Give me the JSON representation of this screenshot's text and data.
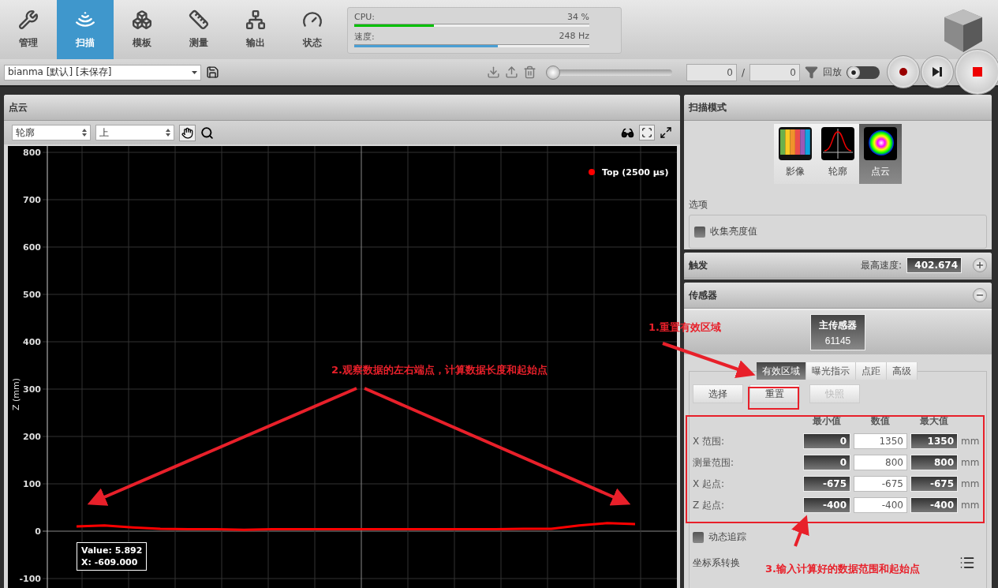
{
  "nav_tabs": [
    {
      "label": "管理",
      "kind": "tools",
      "selected": false
    },
    {
      "label": "扫描",
      "kind": "scan",
      "selected": true
    },
    {
      "label": "模板",
      "kind": "boxes",
      "selected": false
    },
    {
      "label": "测量",
      "kind": "ruler",
      "selected": false
    },
    {
      "label": "输出",
      "kind": "network",
      "selected": false
    },
    {
      "label": "状态",
      "kind": "gauge",
      "selected": false
    }
  ],
  "meters": [
    {
      "label": "CPU:",
      "reading": "34 %",
      "level": 0.34,
      "color": "#00c000"
    },
    {
      "label": "速度:",
      "reading": "248 Hz",
      "level": 0.61,
      "color": "#4a9fd4"
    }
  ],
  "toolbar": {
    "job": "bianma [默认] [未保存]",
    "slider": {
      "level": 0
    },
    "frame": "0",
    "frame_separator": "/",
    "frame_total": "0",
    "playback_label": "回放",
    "playback_on": false
  },
  "point_cloud_panel": {
    "title": "点云",
    "view_select": "轮廓",
    "direction_select": "上",
    "pan_selected": true,
    "chart_data": {
      "type": "line",
      "ylabel": "Z (mm)",
      "ylim": [
        -120,
        800
      ],
      "grid": true,
      "yticks": [
        -100,
        0,
        100,
        200,
        300,
        400,
        500,
        600,
        700,
        800
      ],
      "series": [
        {
          "name": "Top (2500 µs)",
          "color": "#ff0000",
          "values": [
            10,
            12,
            8,
            5,
            4,
            4,
            3,
            4,
            4,
            4,
            4,
            4,
            4,
            4,
            4,
            4,
            5,
            5,
            12,
            17,
            15
          ]
        }
      ]
    },
    "tooltip": [
      "Value: 5.892",
      "X: -609.000"
    ]
  },
  "scan_mode": {
    "title": "扫描模式",
    "modes": [
      {
        "label": "影像",
        "kind": "video",
        "selected": false
      },
      {
        "label": "轮廓",
        "kind": "profile",
        "selected": false
      },
      {
        "label": "点云",
        "kind": "surface",
        "selected": true
      }
    ],
    "options_title": "选项",
    "options": [
      {
        "label": "收集亮度值",
        "checked": false
      }
    ]
  },
  "trigger": {
    "title": "触发",
    "max_speed_label": "最高速度:",
    "max_speed": "402.674",
    "expanded": false
  },
  "sensor": {
    "title": "传感器",
    "expanded": true,
    "sensor_name": "主传感器",
    "sensor_serial": "61145",
    "tabs": [
      {
        "label": "有效区域",
        "selected": true
      },
      {
        "label": "曝光指示",
        "selected": false
      },
      {
        "label": "点距",
        "selected": false
      },
      {
        "label": "高级",
        "selected": false
      }
    ],
    "buttons": [
      {
        "label": "选择",
        "disabled": false
      },
      {
        "label": "重置",
        "disabled": false
      },
      {
        "label": "快照",
        "disabled": true
      }
    ],
    "columns": [
      "最小值",
      "数值",
      "最大值"
    ],
    "rows": [
      {
        "label": "X 范围:",
        "min": "0",
        "value": "1350",
        "max": "1350",
        "unit": "mm"
      },
      {
        "label": "测量范围:",
        "min": "0",
        "value": "800",
        "max": "800",
        "unit": "mm"
      },
      {
        "label": "X 起点:",
        "min": "-675",
        "value": "-675",
        "max": "-675",
        "unit": "mm"
      },
      {
        "label": "Z 起点:",
        "min": "-400",
        "value": "-400",
        "max": "-400",
        "unit": "mm"
      }
    ],
    "tracking": {
      "label": "动态追踪",
      "checked": false
    },
    "transform_label": "坐标系转换"
  },
  "annotations": [
    "1.重置有效区域",
    "2.观察数据的左右端点，计算数据长度和起始点",
    "3.输入计算好的数据范围和起始点"
  ]
}
